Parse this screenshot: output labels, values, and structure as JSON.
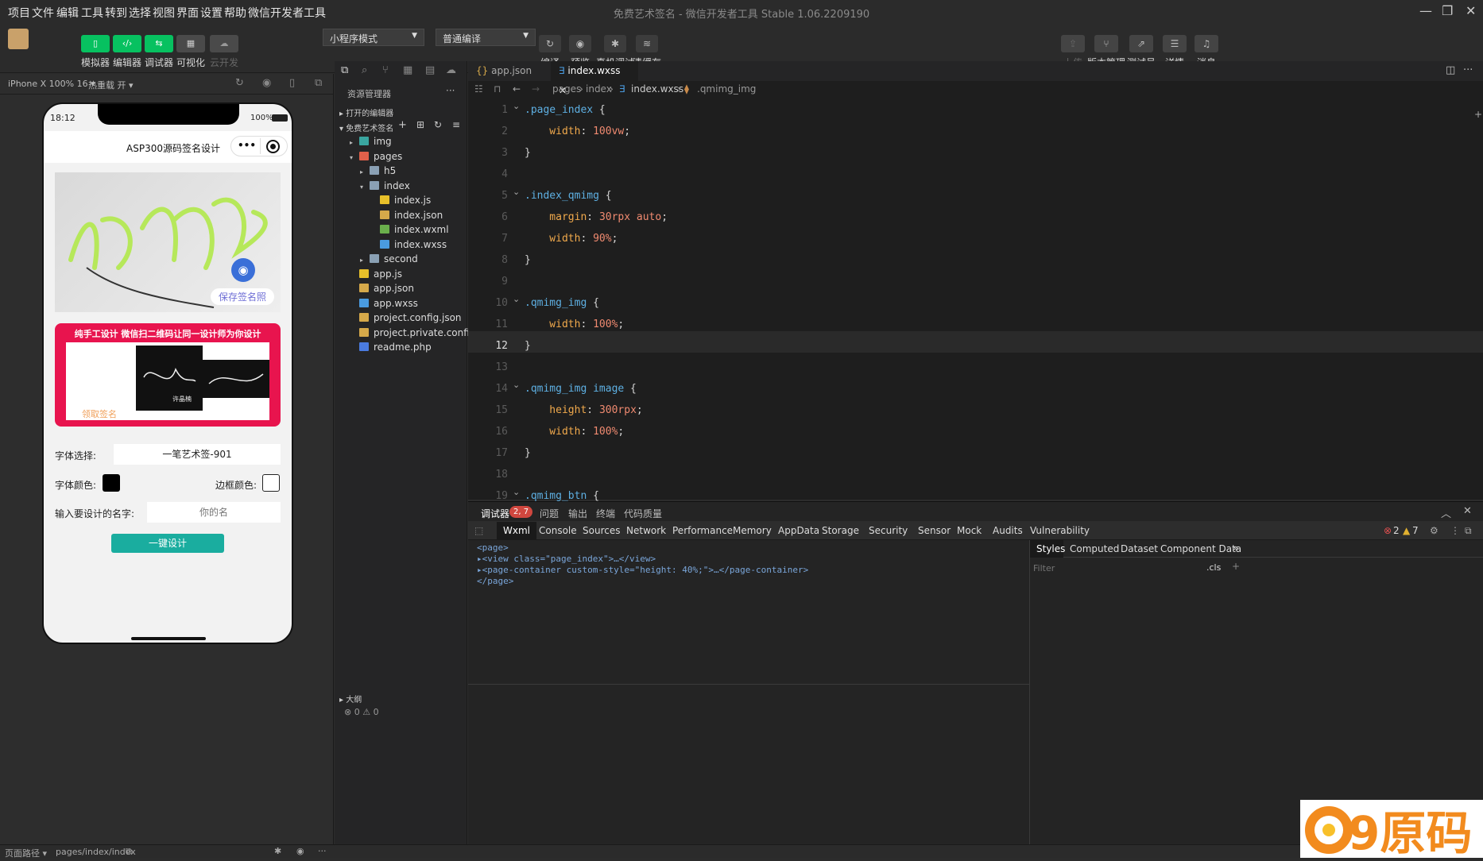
{
  "menubar": {
    "items": [
      "项目",
      "文件",
      "编辑",
      "工具",
      "转到",
      "选择",
      "视图",
      "界面",
      "设置",
      "帮助",
      "微信开发者工具"
    ],
    "title": "免费艺术签名 - 微信开发者工具 Stable 1.06.2209190"
  },
  "toolbar": {
    "left": [
      {
        "label": "模拟器",
        "icon": "phone-icon",
        "glyph": "▯"
      },
      {
        "label": "编辑器",
        "icon": "code-icon",
        "glyph": "‹/›"
      },
      {
        "label": "调试器",
        "icon": "debug-icon",
        "glyph": "⇆"
      },
      {
        "label": "可视化",
        "icon": "layout-icon",
        "glyph": "▦"
      },
      {
        "label": "云开发",
        "icon": "cloud-icon",
        "glyph": "☁"
      }
    ],
    "mode_select": "小程序模式",
    "compile_select": "普通编译",
    "center": [
      {
        "label": "编译",
        "icon": "refresh-icon",
        "glyph": "↻"
      },
      {
        "label": "预览",
        "icon": "eye-icon",
        "glyph": "◉"
      },
      {
        "label": "真机调试",
        "icon": "bug-icon",
        "glyph": "✱"
      },
      {
        "label": "清缓存",
        "icon": "layers-icon",
        "glyph": "≋"
      }
    ],
    "right": [
      {
        "label": "上传",
        "icon": "upload-icon",
        "glyph": "⇪"
      },
      {
        "label": "版本管理",
        "icon": "branch-icon",
        "glyph": "⑂"
      },
      {
        "label": "测试号",
        "icon": "external-icon",
        "glyph": "⇗"
      },
      {
        "label": "详情",
        "icon": "menu-icon",
        "glyph": "☰"
      },
      {
        "label": "消息",
        "icon": "bell-icon",
        "glyph": "♫"
      }
    ]
  },
  "simulator": {
    "device": "iPhone X 100% 16 ▾",
    "hotreload": "热重载 开 ▾",
    "status_time": "18:12",
    "battery": "100%",
    "nav_title": "ASP300源码签名设计",
    "capsule_more": "•••",
    "save_photo": "保存签名照",
    "banner_title": "纯手工设计 微信扫二维码让同一设计师为你设计",
    "banner_link": "领取签名",
    "sig_name": "许晶楠",
    "font_label": "字体选择:",
    "font_value": "一笔艺术签-901",
    "font_color_label": "字体颜色:",
    "border_color_label": "边框颜色:",
    "name_label": "输入要设计的名字:",
    "name_placeholder": "你的名",
    "design_button": "一键设计",
    "colors": {
      "accent": "#1aad9f",
      "banner": "#e8144e",
      "save": "#6f6fd6"
    }
  },
  "explorer": {
    "title": "资源管理器",
    "more": "···",
    "open_editors": "打开的编辑器",
    "project": "免费艺术签名",
    "tree": [
      {
        "name": "img",
        "indent": 1,
        "arrow": "▸",
        "icon": "folder-img-icon",
        "color": "#3aa6a0"
      },
      {
        "name": "pages",
        "indent": 1,
        "arrow": "▾",
        "icon": "folder-pages-icon",
        "color": "#e0604a"
      },
      {
        "name": "h5",
        "indent": 2,
        "arrow": "▸",
        "icon": "folder-icon",
        "color": "#8aa0b4"
      },
      {
        "name": "index",
        "indent": 2,
        "arrow": "▾",
        "icon": "folder-open-icon",
        "color": "#8aa0b4"
      },
      {
        "name": "index.js",
        "indent": 3,
        "arrow": "",
        "icon": "js-file-icon",
        "color": "#e8c02a"
      },
      {
        "name": "index.json",
        "indent": 3,
        "arrow": "",
        "icon": "json-file-icon",
        "color": "#d6a94a"
      },
      {
        "name": "index.wxml",
        "indent": 3,
        "arrow": "",
        "icon": "wxml-file-icon",
        "color": "#6ab04c"
      },
      {
        "name": "index.wxss",
        "indent": 3,
        "arrow": "",
        "icon": "wxss-file-icon",
        "color": "#4a9be0"
      },
      {
        "name": "second",
        "indent": 2,
        "arrow": "▸",
        "icon": "folder-icon",
        "color": "#8aa0b4"
      },
      {
        "name": "app.js",
        "indent": 1,
        "arrow": "",
        "icon": "js-file-icon",
        "color": "#e8c02a"
      },
      {
        "name": "app.json",
        "indent": 1,
        "arrow": "",
        "icon": "json-file-icon",
        "color": "#d6a94a"
      },
      {
        "name": "app.wxss",
        "indent": 1,
        "arrow": "",
        "icon": "wxss-file-icon",
        "color": "#4a9be0"
      },
      {
        "name": "project.config.json",
        "indent": 1,
        "arrow": "",
        "icon": "json-file-icon",
        "color": "#d6a94a"
      },
      {
        "name": "project.private.config.js...",
        "indent": 1,
        "arrow": "",
        "icon": "json-file-icon",
        "color": "#d6a94a"
      },
      {
        "name": "readme.php",
        "indent": 1,
        "arrow": "",
        "icon": "php-file-icon",
        "color": "#4a7be0"
      }
    ],
    "outline": "大纲",
    "errors": "⊗ 0 ⚠ 0"
  },
  "editor": {
    "tabs": [
      {
        "label": "app.json",
        "icon": "{}"
      },
      {
        "label": "index.wxss",
        "icon": "∃",
        "active": true
      }
    ],
    "breadcrumb": [
      "pages",
      "index",
      "index.wxss",
      ".qmimg_img"
    ],
    "lines": [
      {
        "n": "1",
        "t": ".page_index {",
        "k": "sel"
      },
      {
        "n": "2",
        "t": "    width: 100vw;",
        "k": "prop"
      },
      {
        "n": "3",
        "t": "}",
        "k": "p"
      },
      {
        "n": "4",
        "t": "",
        "k": "p"
      },
      {
        "n": "5",
        "t": ".index_qmimg {",
        "k": "sel"
      },
      {
        "n": "6",
        "t": "    margin: 30rpx auto;",
        "k": "prop"
      },
      {
        "n": "7",
        "t": "    width: 90%;",
        "k": "prop"
      },
      {
        "n": "8",
        "t": "}",
        "k": "p"
      },
      {
        "n": "9",
        "t": "",
        "k": "p"
      },
      {
        "n": "10",
        "t": ".qmimg_img {",
        "k": "sel"
      },
      {
        "n": "11",
        "t": "    width: 100%;",
        "k": "prop"
      },
      {
        "n": "12",
        "t": "}",
        "k": "p"
      },
      {
        "n": "13",
        "t": "",
        "k": "p"
      },
      {
        "n": "14",
        "t": ".qmimg_img image {",
        "k": "sel"
      },
      {
        "n": "15",
        "t": "    height: 300rpx;",
        "k": "prop"
      },
      {
        "n": "16",
        "t": "    width: 100%;",
        "k": "prop"
      },
      {
        "n": "17",
        "t": "}",
        "k": "p"
      },
      {
        "n": "18",
        "t": "",
        "k": "p"
      },
      {
        "n": "19",
        "t": ".qmimg_btn {",
        "k": "sel"
      }
    ],
    "active_line": "12"
  },
  "debugger": {
    "tabs": [
      "调试器",
      "问题",
      "输出",
      "终端",
      "代码质量"
    ],
    "badge": "2, 7",
    "devtabs": [
      "Wxml",
      "Console",
      "Sources",
      "Network",
      "Performance",
      "Memory",
      "AppData",
      "Storage",
      "Security",
      "Sensor",
      "Mock",
      "Audits",
      "Vulnerability"
    ],
    "err_count": "2",
    "warn_count": "7",
    "dom": [
      "<page>",
      "▸<view class=\"page_index\">…</view>",
      "▸<page-container custom-style=\"height: 40%;\">…</page-container>",
      "</page>"
    ],
    "style_tabs": [
      "Styles",
      "Computed",
      "Dataset",
      "Component Data"
    ],
    "filter": "Filter",
    "cls": ".cls"
  },
  "status": {
    "path_label": "页面路径 ▾",
    "path": "pages/index/index"
  },
  "watermark": "Q9原码"
}
